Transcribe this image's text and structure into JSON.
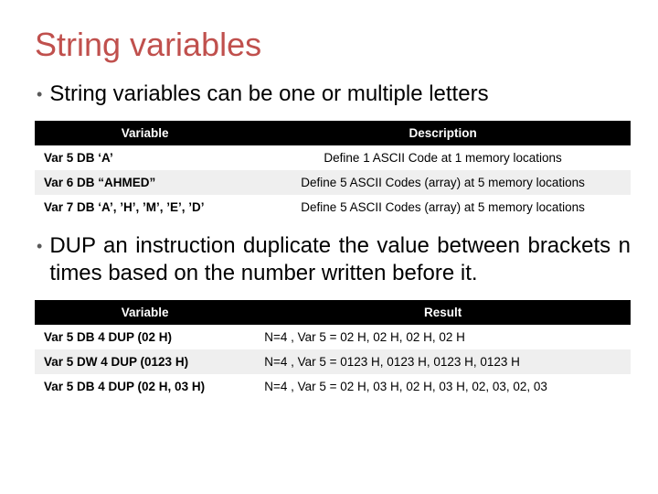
{
  "title": "String variables",
  "bullet1_prefix": "String",
  "bullet1_rest": " variables can be one or multiple letters",
  "bullet2_prefix": "DUP",
  "bullet2_rest": " an instruction duplicate the value between brackets n times based on the number written before it.",
  "table1": {
    "headers": [
      "Variable",
      "Description"
    ],
    "rows": [
      {
        "var": "Var 5 DB ‘A’",
        "desc": "Define 1 ASCII Code at 1 memory locations"
      },
      {
        "var": "Var 6 DB “AHMED”",
        "desc": "Define 5 ASCII Codes (array) at 5 memory locations"
      },
      {
        "var": "Var 7 DB ‘A’, ’H’, ’M’, ’E’, ’D’",
        "desc": "Define 5 ASCII Codes (array) at 5 memory locations"
      }
    ]
  },
  "table2": {
    "headers": [
      "Variable",
      "Result"
    ],
    "rows": [
      {
        "var": "Var 5 DB 4 DUP (02 H)",
        "desc": "N=4 , Var 5 = 02 H, 02 H, 02 H, 02 H"
      },
      {
        "var": "Var 5 DW 4 DUP (0123 H)",
        "desc": "N=4 , Var 5 = 0123 H, 0123 H, 0123 H, 0123 H"
      },
      {
        "var": "Var 5 DB 4 DUP (02 H, 03 H)",
        "desc": "N=4 , Var 5 = 02 H, 03 H, 02 H, 03 H, 02, 03, 02, 03"
      }
    ]
  }
}
